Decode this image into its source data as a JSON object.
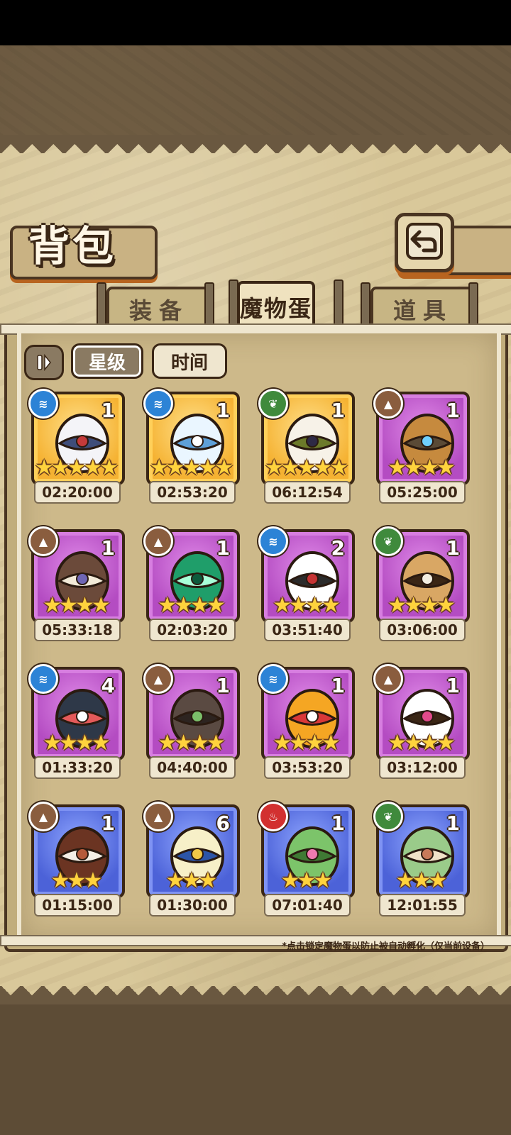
{
  "header": {
    "title": "背包"
  },
  "tabs": [
    {
      "label": "装备",
      "active": false
    },
    {
      "label": "魔物蛋",
      "active": true
    },
    {
      "label": "道具",
      "active": false
    }
  ],
  "sort": {
    "star_label": "星级",
    "time_label": "时间",
    "selected": "星级"
  },
  "eggs": [
    {
      "element": "water",
      "element_icon": "water-ripple-icon",
      "count": "1",
      "stars": "★★★★★",
      "timer": "02:20:00",
      "frame": "gold"
    },
    {
      "element": "water",
      "element_icon": "water-ripple-icon",
      "count": "1",
      "stars": "★★★★★",
      "timer": "02:53:20",
      "frame": "gold"
    },
    {
      "element": "nature",
      "element_icon": "leaf-icon",
      "count": "1",
      "stars": "★★★★★",
      "timer": "06:12:54",
      "frame": "gold"
    },
    {
      "element": "earth",
      "element_icon": "mountain-icon",
      "count": "1",
      "stars": "★★★★",
      "timer": "05:25:00",
      "frame": "purple"
    },
    {
      "element": "earth",
      "element_icon": "mountain-icon",
      "count": "1",
      "stars": "★★★★",
      "timer": "05:33:18",
      "frame": "purple"
    },
    {
      "element": "earth",
      "element_icon": "mountain-icon",
      "count": "1",
      "stars": "★★★★",
      "timer": "02:03:20",
      "frame": "purple"
    },
    {
      "element": "water",
      "element_icon": "water-ripple-icon",
      "count": "2",
      "stars": "★★★★",
      "timer": "03:51:40",
      "frame": "purple"
    },
    {
      "element": "nature",
      "element_icon": "leaf-icon",
      "count": "1",
      "stars": "★★★★",
      "timer": "03:06:00",
      "frame": "purple"
    },
    {
      "element": "water",
      "element_icon": "water-ripple-icon",
      "count": "4",
      "stars": "★★★★",
      "timer": "01:33:20",
      "frame": "purple"
    },
    {
      "element": "earth",
      "element_icon": "mountain-icon",
      "count": "1",
      "stars": "★★★★",
      "timer": "04:40:00",
      "frame": "purple"
    },
    {
      "element": "water",
      "element_icon": "water-ripple-icon",
      "count": "1",
      "stars": "★★★★",
      "timer": "03:53:20",
      "frame": "purple"
    },
    {
      "element": "earth",
      "element_icon": "mountain-icon",
      "count": "1",
      "stars": "★★★★",
      "timer": "03:12:00",
      "frame": "purple"
    },
    {
      "element": "earth",
      "element_icon": "mountain-icon",
      "count": "1",
      "stars": "★★★",
      "timer": "01:15:00",
      "frame": "blue"
    },
    {
      "element": "earth",
      "element_icon": "mountain-icon",
      "count": "6",
      "stars": "★★★",
      "timer": "01:30:00",
      "frame": "blue"
    },
    {
      "element": "fire",
      "element_icon": "flame-icon",
      "count": "1",
      "stars": "★★★",
      "timer": "07:01:40",
      "frame": "blue"
    },
    {
      "element": "nature",
      "element_icon": "leaf-icon",
      "count": "1",
      "stars": "★★★",
      "timer": "12:01:55",
      "frame": "blue"
    }
  ],
  "footnote": "*点击锁定魔物蛋以防止被自动孵化（仅当前设备）",
  "colors": {
    "gold_frame": "#f5b232",
    "purple_frame": "#b44cc2",
    "blue_frame": "#4c62d8",
    "water": "#2c83d6",
    "nature": "#3f8a3c",
    "earth": "#8a5d3e",
    "fire": "#d23030"
  }
}
